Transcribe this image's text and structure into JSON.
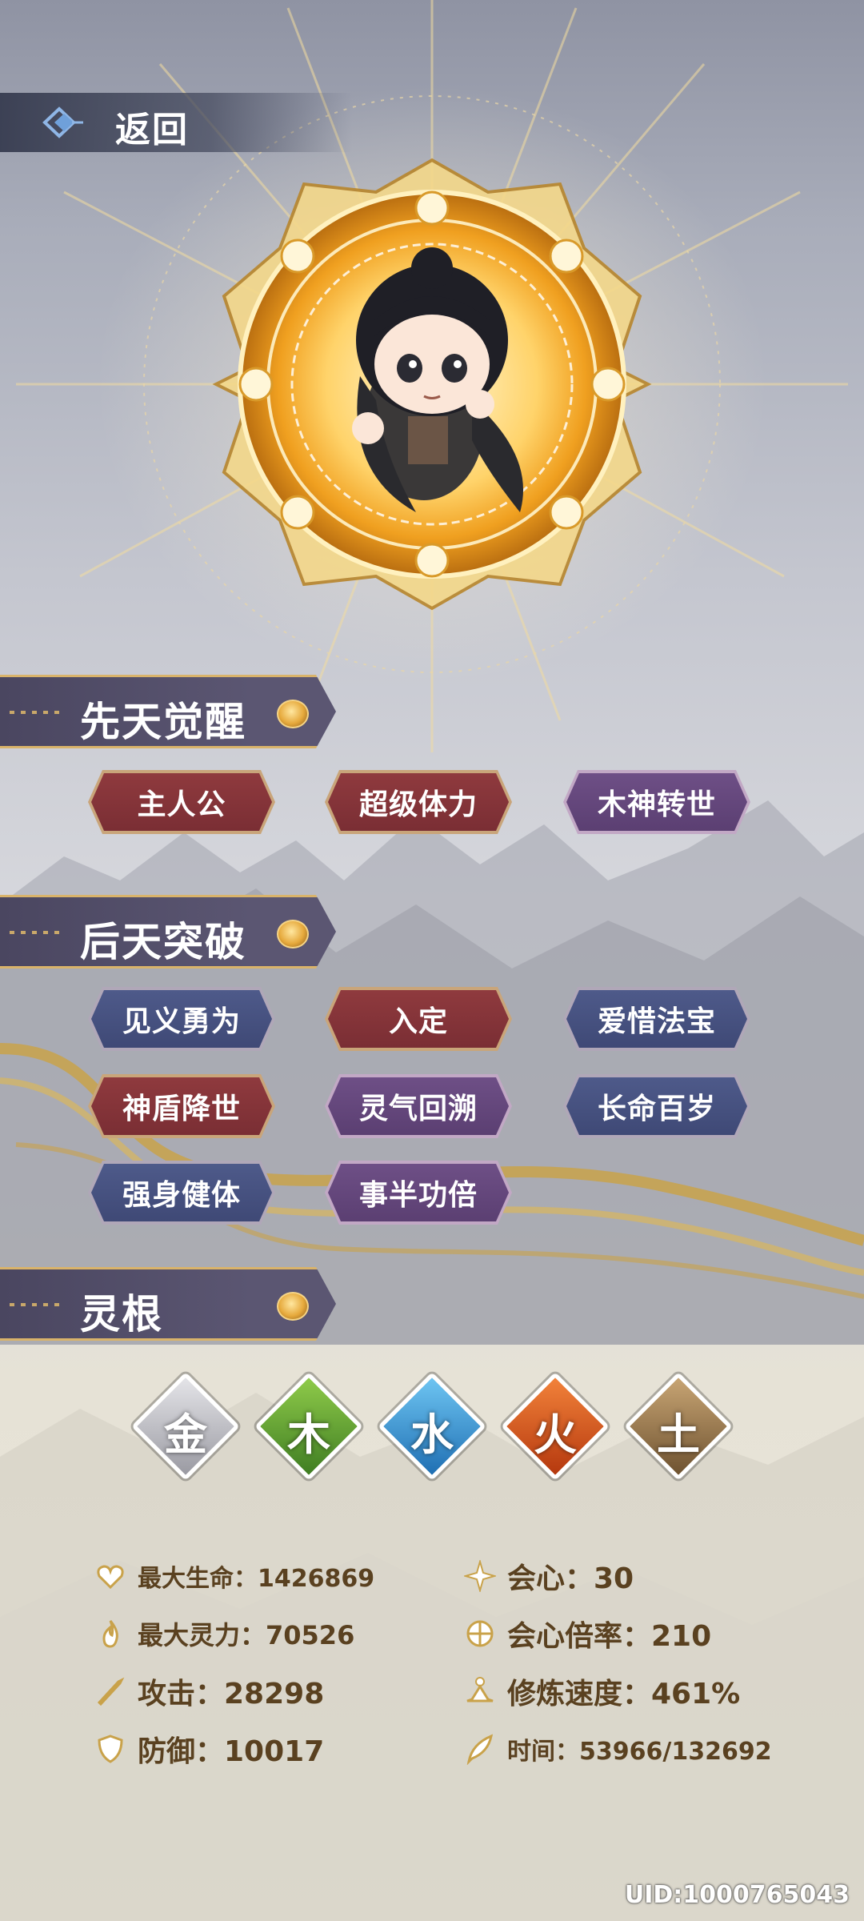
{
  "topbar": {
    "back_label": "返回",
    "back_icon": "back-diamond-icon"
  },
  "avatar": {
    "name": "character-portrait"
  },
  "sections": {
    "innate": {
      "title": "先天觉醒",
      "tags": [
        {
          "label": "主人公",
          "color": "red"
        },
        {
          "label": "超级体力",
          "color": "red"
        },
        {
          "label": "木神转世",
          "color": "purple"
        }
      ]
    },
    "acquired": {
      "title": "后天突破",
      "tags": [
        {
          "label": "见义勇为",
          "color": "blue"
        },
        {
          "label": "入定",
          "color": "red"
        },
        {
          "label": "爱惜法宝",
          "color": "blue"
        },
        {
          "label": "神盾降世",
          "color": "red"
        },
        {
          "label": "灵气回溯",
          "color": "purple"
        },
        {
          "label": "长命百岁",
          "color": "blue"
        },
        {
          "label": "强身健体",
          "color": "blue"
        },
        {
          "label": "事半功倍",
          "color": "purple"
        }
      ]
    },
    "roots": {
      "title": "灵根",
      "elements": [
        {
          "glyph": "金",
          "color": "#b9b9bd"
        },
        {
          "glyph": "木",
          "color": "#6aa53a"
        },
        {
          "glyph": "水",
          "color": "#3a8fd0"
        },
        {
          "glyph": "火",
          "color": "#d75a1e"
        },
        {
          "glyph": "土",
          "color": "#9a7a4a"
        }
      ]
    }
  },
  "stats": {
    "max_hp": "最大生命：1426869",
    "max_mana": "最大灵力：70526",
    "attack": "攻击：28298",
    "defense": "防御：10017",
    "crit": "会心：30",
    "crit_rate": "会心倍率：210",
    "cultivation_speed": "修炼速度：461%",
    "time": "时间：53966/132692"
  },
  "uid": "UID:1000765043"
}
